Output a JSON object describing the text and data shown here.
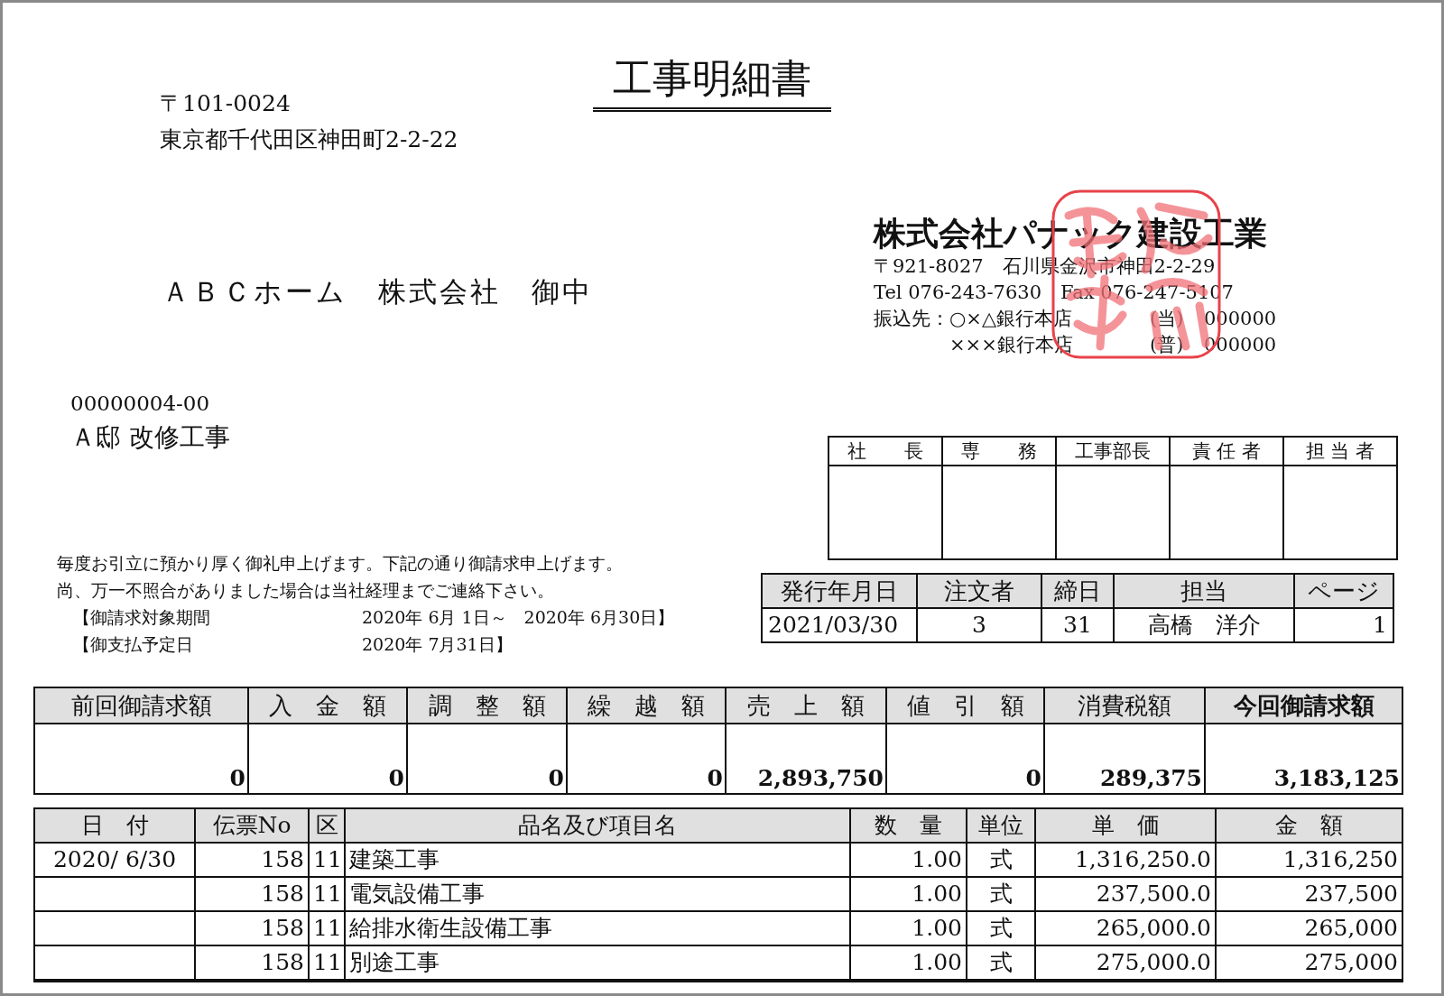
{
  "title": "工事明細書",
  "recipient": {
    "postal": "〒101-0024",
    "address": "東京都千代田区神田町2-2-22",
    "name": "ＡＢＣホーム　株式会社　御中"
  },
  "issuer": {
    "name": "株式会社パナック建設工業",
    "address": "〒921-8027　石川県金沢市神田2-2-29",
    "contact": "Tel 076-243-7630　Fax 076-247-5107",
    "bank_label": "振込先：",
    "bank_accounts": [
      {
        "bank": "○×△銀行本店",
        "type": "(当)",
        "number": "000000"
      },
      {
        "bank": "×××銀行本店",
        "type": "(普)",
        "number": "000000"
      }
    ]
  },
  "project": {
    "code": "00000004-00",
    "name": "Ａ邸 改修工事"
  },
  "approval_headers": [
    "社　　長",
    "専　　務",
    "工事部長",
    "責 任 者",
    "担 当 者"
  ],
  "message": [
    "毎度お引立に預かり厚く御礼申上げます。下記の通り御請求申上げます。",
    "尚、万一不照合がありました場合は当社経理までご連絡下さい。"
  ],
  "periods": [
    {
      "label": "【御請求対象期間",
      "value": "2020年 6月 1日～　2020年 6月30日】"
    },
    {
      "label": "【御支払予定日",
      "value": "2020年 7月31日】"
    }
  ],
  "issue_info": [
    {
      "label": "発行年月日",
      "value": "2021/03/30"
    },
    {
      "label": "注文者",
      "value": "3"
    },
    {
      "label": "締日",
      "value": "31"
    },
    {
      "label": "担当",
      "value": "高橋　洋介"
    },
    {
      "label": "ページ",
      "value": "1"
    }
  ],
  "summary": [
    {
      "label": "前回御請求額",
      "value": "0",
      "total": false
    },
    {
      "label": "入　金　額",
      "value": "0",
      "total": false
    },
    {
      "label": "調　整　額",
      "value": "0",
      "total": false
    },
    {
      "label": "繰　越　額",
      "value": "0",
      "total": false
    },
    {
      "label": "売　上　額",
      "value": "2,893,750",
      "total": false
    },
    {
      "label": "値　引　額",
      "value": "0",
      "total": false
    },
    {
      "label": "消費税額",
      "value": "289,375",
      "total": false
    },
    {
      "label": "今回御請求額",
      "value": "3,183,125",
      "total": true
    }
  ],
  "items": {
    "columns": [
      "日　付",
      "伝票No",
      "区",
      "品名及び項目名",
      "数　量",
      "単位",
      "単　価",
      "金　額"
    ],
    "rows": [
      {
        "date": "2020/ 6/30",
        "slip_no": "158",
        "category": "11",
        "name": "建築工事",
        "quantity": "1.00",
        "unit": "式",
        "unit_price": "1,316,250.0",
        "amount": "1,316,250"
      },
      {
        "slip_no": "158",
        "category": "11",
        "name": "電気設備工事",
        "quantity": "1.00",
        "unit": "式",
        "unit_price": "237,500.0",
        "amount": "237,500"
      },
      {
        "slip_no": "158",
        "category": "11",
        "name": "給排水衛生設備工事",
        "quantity": "1.00",
        "unit": "式",
        "unit_price": "265,000.0",
        "amount": "265,000"
      },
      {
        "slip_no": "158",
        "category": "11",
        "name": "別途工事",
        "quantity": "1.00",
        "unit": "式",
        "unit_price": "275,000.0",
        "amount": "275,000"
      }
    ]
  }
}
